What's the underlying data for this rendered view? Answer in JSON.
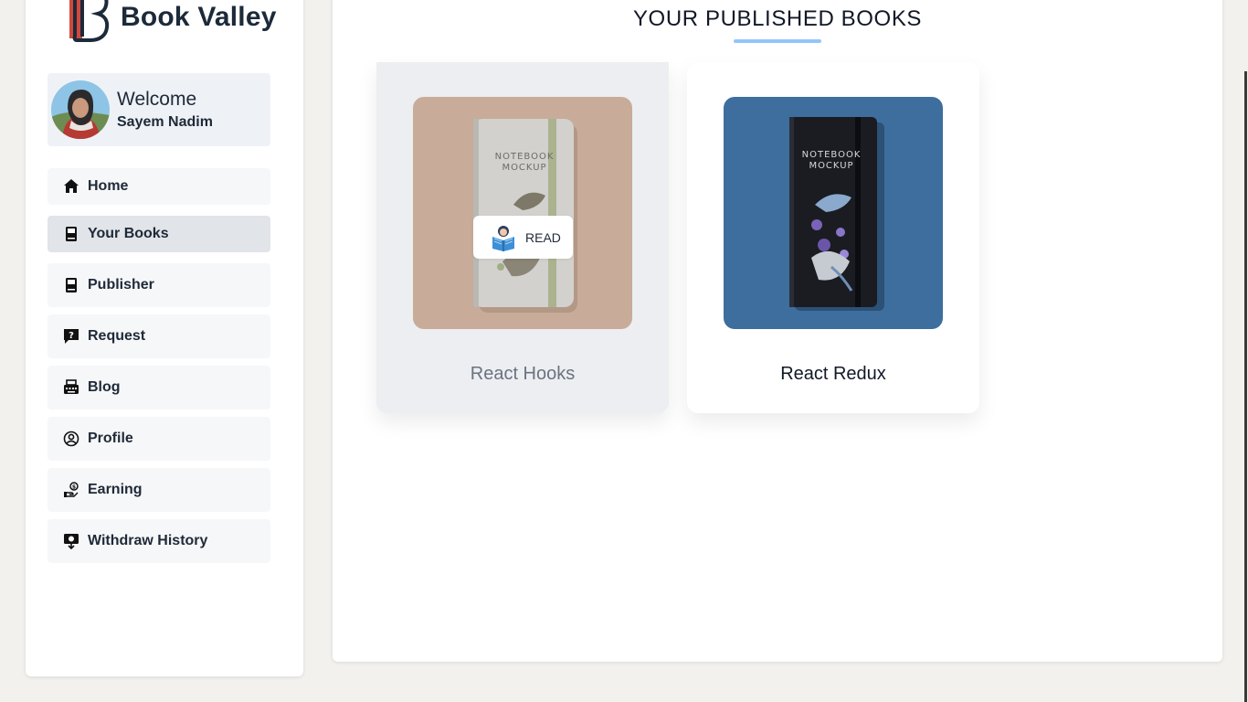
{
  "app": {
    "name": "Book Valley"
  },
  "user": {
    "welcome": "Welcome",
    "name": "Sayem Nadim"
  },
  "sidebar": {
    "items": [
      {
        "label": "Home",
        "icon": "home-icon"
      },
      {
        "label": "Your Books",
        "icon": "book-icon",
        "active": true
      },
      {
        "label": "Publisher",
        "icon": "book-icon"
      },
      {
        "label": "Request",
        "icon": "question-chat-icon"
      },
      {
        "label": "Blog",
        "icon": "typewriter-icon"
      },
      {
        "label": "Profile",
        "icon": "user-circle-icon"
      },
      {
        "label": "Earning",
        "icon": "money-hand-icon"
      },
      {
        "label": "Withdraw History",
        "icon": "download-monitor-icon"
      }
    ]
  },
  "main": {
    "title": "YOUR PUBLISHED BOOKS",
    "books": [
      {
        "title": "React Hooks",
        "cover_text_1": "NOTEBOOK",
        "cover_text_2": "MOCKUP",
        "read_label": "READ",
        "hovered": true
      },
      {
        "title": "React Redux",
        "cover_text_1": "NOTEBOOK",
        "cover_text_2": "MOCKUP"
      }
    ]
  },
  "colors": {
    "accent_underline": "#93c5fd",
    "brand_text": "#1c2a3a",
    "logo_red": "#c0392b"
  }
}
